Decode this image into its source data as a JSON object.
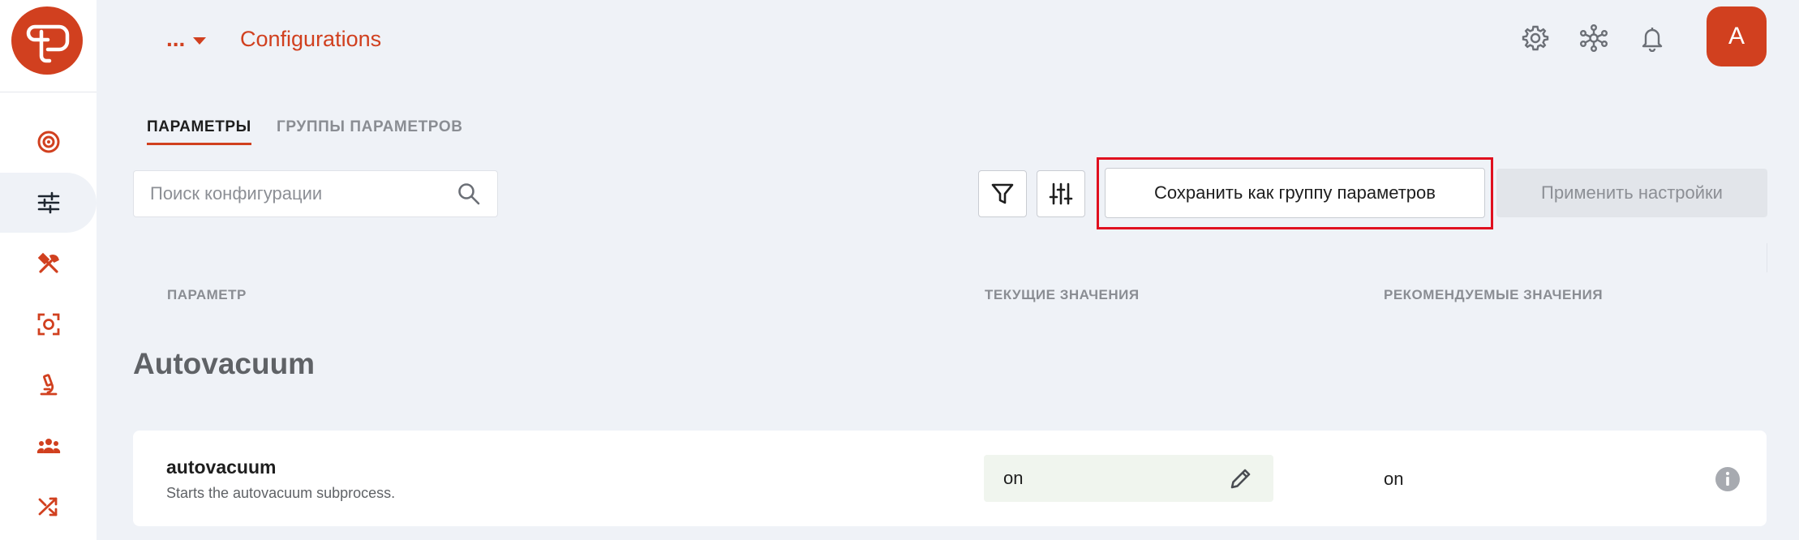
{
  "app": {
    "title": "Configurations",
    "breadcrumb_more": "...",
    "avatar_initial": "A",
    "accent_color": "#d1401f"
  },
  "sidebar": {
    "items": [
      {
        "icon": "target-icon"
      },
      {
        "icon": "sliders-icon",
        "active": true
      },
      {
        "icon": "tools-icon"
      },
      {
        "icon": "focus-icon"
      },
      {
        "icon": "microscope-icon"
      },
      {
        "icon": "group-icon"
      },
      {
        "icon": "shuffle-icon"
      }
    ]
  },
  "header_icons": [
    "gear-icon",
    "network-icon",
    "bell-icon"
  ],
  "tabs": [
    {
      "label": "ПАРАМЕТРЫ",
      "active": true
    },
    {
      "label": "ГРУППЫ ПАРАМЕТРОВ",
      "active": false
    }
  ],
  "search": {
    "placeholder": "Поиск конфигурации",
    "value": ""
  },
  "toolbar": {
    "save_group_label": "Сохранить как группу параметров",
    "apply_label": "Применить настройки"
  },
  "table": {
    "columns": [
      "ПАРАМЕТР",
      "ТЕКУЩИЕ ЗНАЧЕНИЯ",
      "РЕКОМЕНДУЕМЫЕ ЗНАЧЕНИЯ"
    ],
    "section": "Autovacuum",
    "rows": [
      {
        "name": "autovacuum",
        "description": "Starts the autovacuum subprocess.",
        "current": "on",
        "recommended": "on"
      }
    ]
  }
}
